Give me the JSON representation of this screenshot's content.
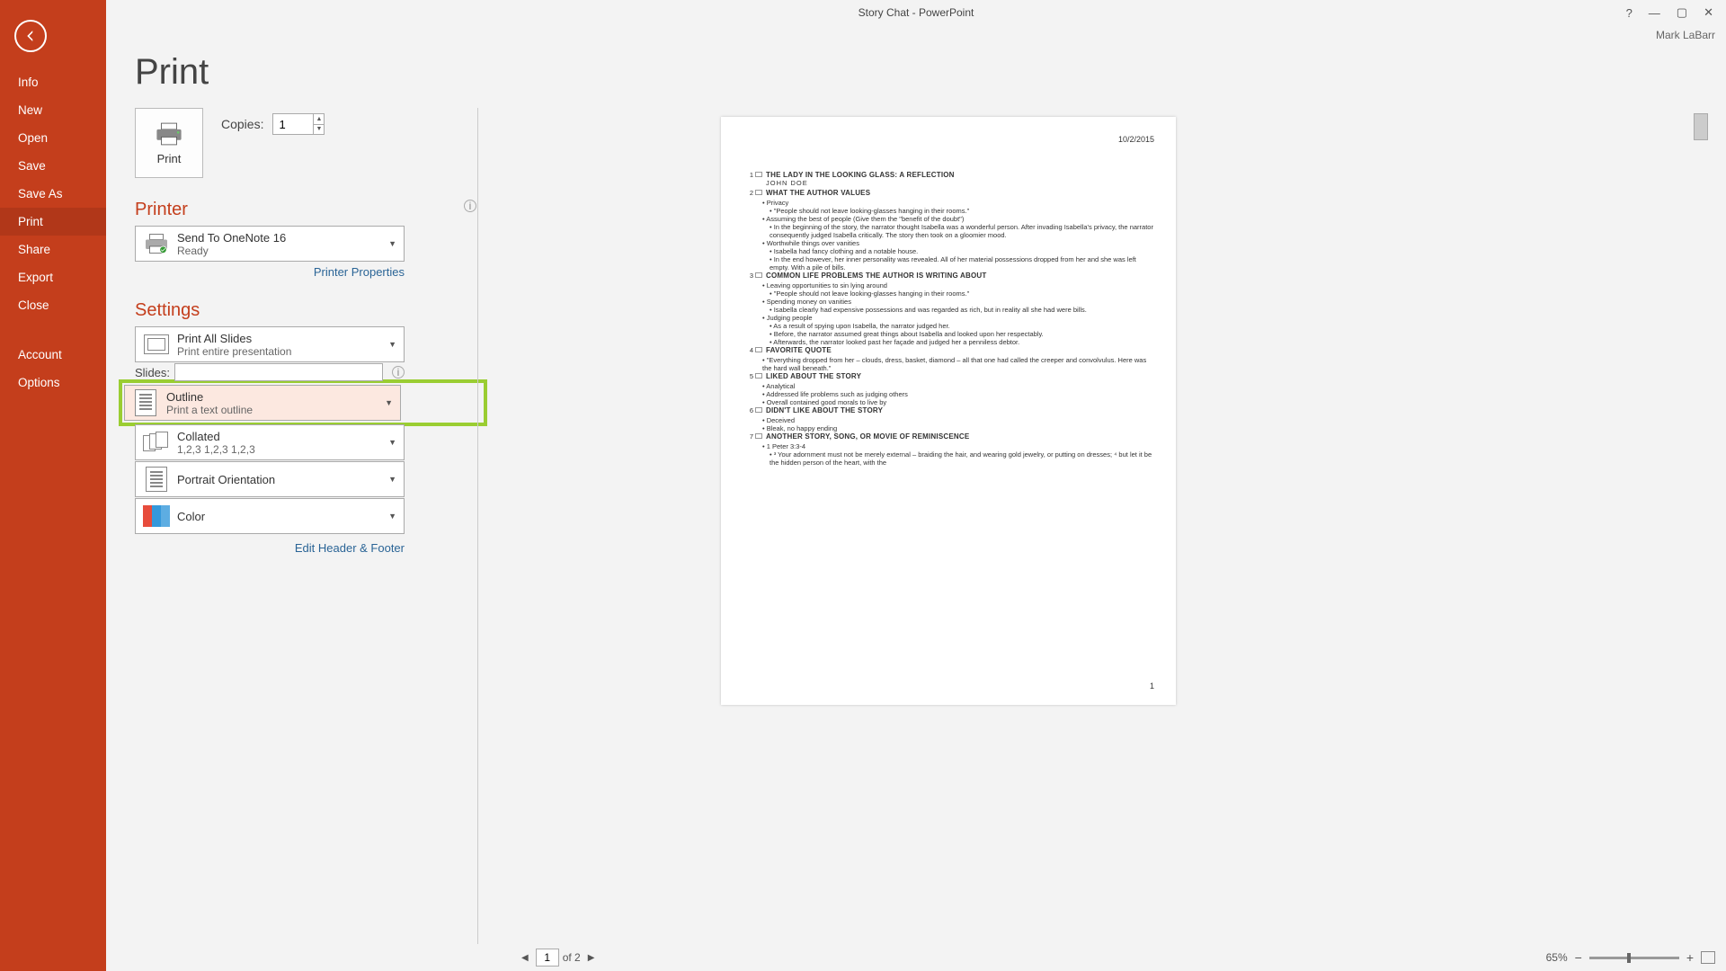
{
  "window": {
    "title": "Story Chat - PowerPoint",
    "user": "Mark LaBarr"
  },
  "sidebar": {
    "items": [
      "Info",
      "New",
      "Open",
      "Save",
      "Save As",
      "Print",
      "Share",
      "Export",
      "Close"
    ],
    "bottom": [
      "Account",
      "Options"
    ],
    "active": "Print"
  },
  "page": {
    "title": "Print"
  },
  "print": {
    "button_label": "Print",
    "copies_label": "Copies:",
    "copies_value": "1"
  },
  "printer": {
    "heading": "Printer",
    "name": "Send To OneNote 16",
    "status": "Ready",
    "properties_link": "Printer Properties"
  },
  "settings": {
    "heading": "Settings",
    "print_what": {
      "title": "Print All Slides",
      "sub": "Print entire presentation"
    },
    "slides_label": "Slides:",
    "slides_value": "",
    "layout": {
      "title": "Outline",
      "sub": "Print a text outline"
    },
    "collate": {
      "title": "Collated",
      "sub": "1,2,3    1,2,3    1,2,3"
    },
    "orientation": {
      "title": "Portrait Orientation"
    },
    "color": {
      "title": "Color"
    },
    "edit_header_link": "Edit Header & Footer"
  },
  "preview": {
    "date": "10/2/2015",
    "page_number": "1",
    "slides": [
      {
        "n": "1",
        "title": "THE LADY IN THE LOOKING GLASS: A REFLECTION",
        "author": "JOHN DOE",
        "bullets": []
      },
      {
        "n": "2",
        "title": "WHAT THE AUTHOR VALUES",
        "bullets": [
          {
            "l": 1,
            "t": "Privacy"
          },
          {
            "l": 2,
            "t": "\"People should not leave looking-glasses hanging in their rooms.\""
          },
          {
            "l": 1,
            "t": "Assuming the best of people (Give them the \"benefit of the doubt\")"
          },
          {
            "l": 2,
            "t": "In the beginning of the story, the narrator thought Isabella was a wonderful person. After invading Isabella's privacy, the narrator consequently judged Isabella critically. The story then took on a gloomier mood."
          },
          {
            "l": 1,
            "t": "Worthwhile things over vanities"
          },
          {
            "l": 2,
            "t": "Isabella had fancy clothing and a notable house."
          },
          {
            "l": 2,
            "t": "In the end however, her inner personality was revealed. All of her material possessions dropped from her and she was left empty. With a pile of bills."
          }
        ]
      },
      {
        "n": "3",
        "title": "COMMON LIFE PROBLEMS THE AUTHOR IS WRITING ABOUT",
        "bullets": [
          {
            "l": 1,
            "t": "Leaving opportunities to sin lying around"
          },
          {
            "l": 2,
            "t": "\"People should not leave looking-glasses hanging in their rooms.\""
          },
          {
            "l": 1,
            "t": "Spending money on vanities"
          },
          {
            "l": 2,
            "t": "Isabella clearly had expensive possessions and was regarded as rich, but in reality all she had were bills."
          },
          {
            "l": 1,
            "t": "Judging people"
          },
          {
            "l": 2,
            "t": "As a result of spying upon Isabella, the narrator judged her."
          },
          {
            "l": 2,
            "t": "Before, the narrator assumed great things about Isabella and looked upon her respectably."
          },
          {
            "l": 2,
            "t": "Afterwards, the narrator looked past her façade and judged her a penniless debtor."
          }
        ]
      },
      {
        "n": "4",
        "title": "FAVORITE QUOTE",
        "bullets": [
          {
            "l": 1,
            "t": "\"Everything dropped from her – clouds, dress, basket, diamond – all that one had called the creeper and convolvulus. Here was the hard wall beneath.\""
          }
        ]
      },
      {
        "n": "5",
        "title": "LIKED ABOUT THE STORY",
        "bullets": [
          {
            "l": 1,
            "t": "Analytical"
          },
          {
            "l": 1,
            "t": "Addressed life problems such as judging others"
          },
          {
            "l": 1,
            "t": "Overall contained good morals to live by"
          }
        ]
      },
      {
        "n": "6",
        "title": "DIDN'T LIKE ABOUT THE STORY",
        "bullets": [
          {
            "l": 1,
            "t": "Deceived"
          },
          {
            "l": 1,
            "t": "Bleak, no happy ending"
          }
        ]
      },
      {
        "n": "7",
        "title": "ANOTHER STORY, SONG, OR MOVIE OF REMINISCENCE",
        "bullets": [
          {
            "l": 1,
            "t": "1 Peter 3:3-4"
          },
          {
            "l": 2,
            "t": "³ Your adornment must not be merely external – braiding the hair, and wearing gold jewelry, or putting on dresses; ⁴ but let it be the hidden person of the heart, with the"
          }
        ]
      }
    ]
  },
  "status": {
    "current_page": "1",
    "of_label": "of 2",
    "zoom": "65%"
  }
}
